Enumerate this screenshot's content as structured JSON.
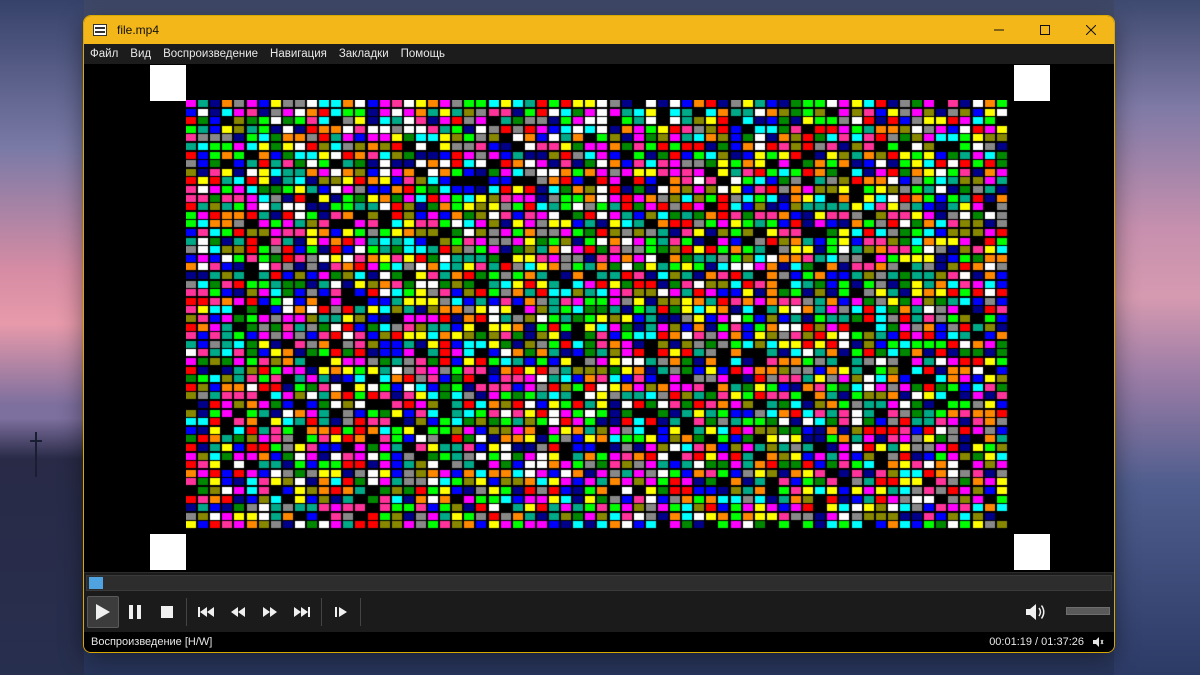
{
  "window": {
    "title": "file.mp4",
    "frame_color": "#f3b71a"
  },
  "menu": {
    "items": [
      "Файл",
      "Вид",
      "Воспроизведение",
      "Навигация",
      "Закладки",
      "Помощь"
    ]
  },
  "video": {
    "content": "color-noise-test-pattern",
    "corner_marker_color": "#ffffff",
    "palette": [
      "#ff0000",
      "#00ff00",
      "#0000ff",
      "#ffff00",
      "#ff00ff",
      "#00ffff",
      "#ffffff",
      "#ff3399",
      "#008800",
      "#000088",
      "#888800",
      "#888888",
      "#ff8800",
      "#00aa88"
    ]
  },
  "playback": {
    "progress": 0.0136,
    "buttons": [
      "play",
      "pause",
      "stop",
      "previous",
      "rewind",
      "forward",
      "next",
      "frame-step"
    ],
    "active_button": "play",
    "volume": 0.0
  },
  "status": {
    "state": "Воспроизведение [H/W]",
    "time": "00:01:19 / 01:37:26"
  },
  "icons": {
    "play": "play-icon",
    "pause": "pause-icon",
    "stop": "stop-icon",
    "previous": "skip-previous-icon",
    "rewind": "rewind-icon",
    "forward": "fast-forward-icon",
    "next": "skip-next-icon",
    "frame_step": "frame-step-icon",
    "volume": "speaker-icon"
  }
}
